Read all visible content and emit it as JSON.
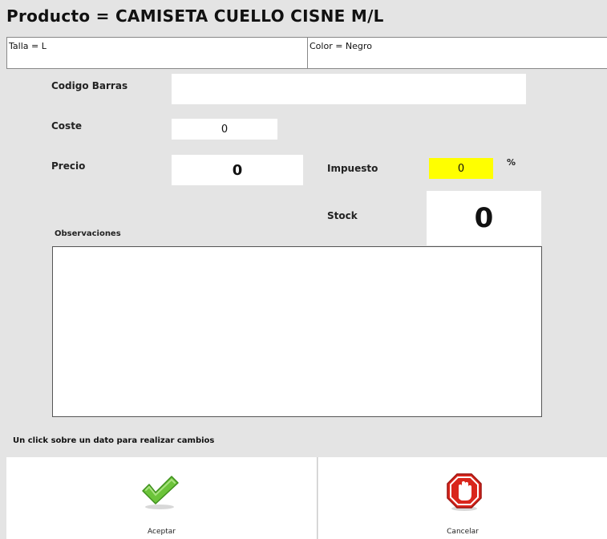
{
  "header": {
    "title": "Producto = CAMISETA CUELLO CISNE M/L"
  },
  "attributes": {
    "talla": "Talla = L",
    "color": "Color = Negro"
  },
  "form": {
    "codigo_barras": {
      "label": "Codigo Barras",
      "value": ""
    },
    "coste": {
      "label": "Coste",
      "value": "0"
    },
    "precio": {
      "label": "Precio",
      "value": "0"
    },
    "impuesto": {
      "label": "Impuesto",
      "value": "0",
      "unit": "%",
      "highlight_color": "#ffff00"
    },
    "stock": {
      "label": "Stock",
      "value": "0"
    },
    "observaciones": {
      "label": "Observaciones",
      "value": ""
    }
  },
  "hint": "Un click sobre un dato para realizar cambios",
  "buttons": {
    "accept": {
      "label": "Aceptar",
      "icon": "checkmark-icon",
      "color": "#5cb82e"
    },
    "cancel": {
      "label": "Cancelar",
      "icon": "stop-hand-icon",
      "color": "#d9261c"
    }
  }
}
